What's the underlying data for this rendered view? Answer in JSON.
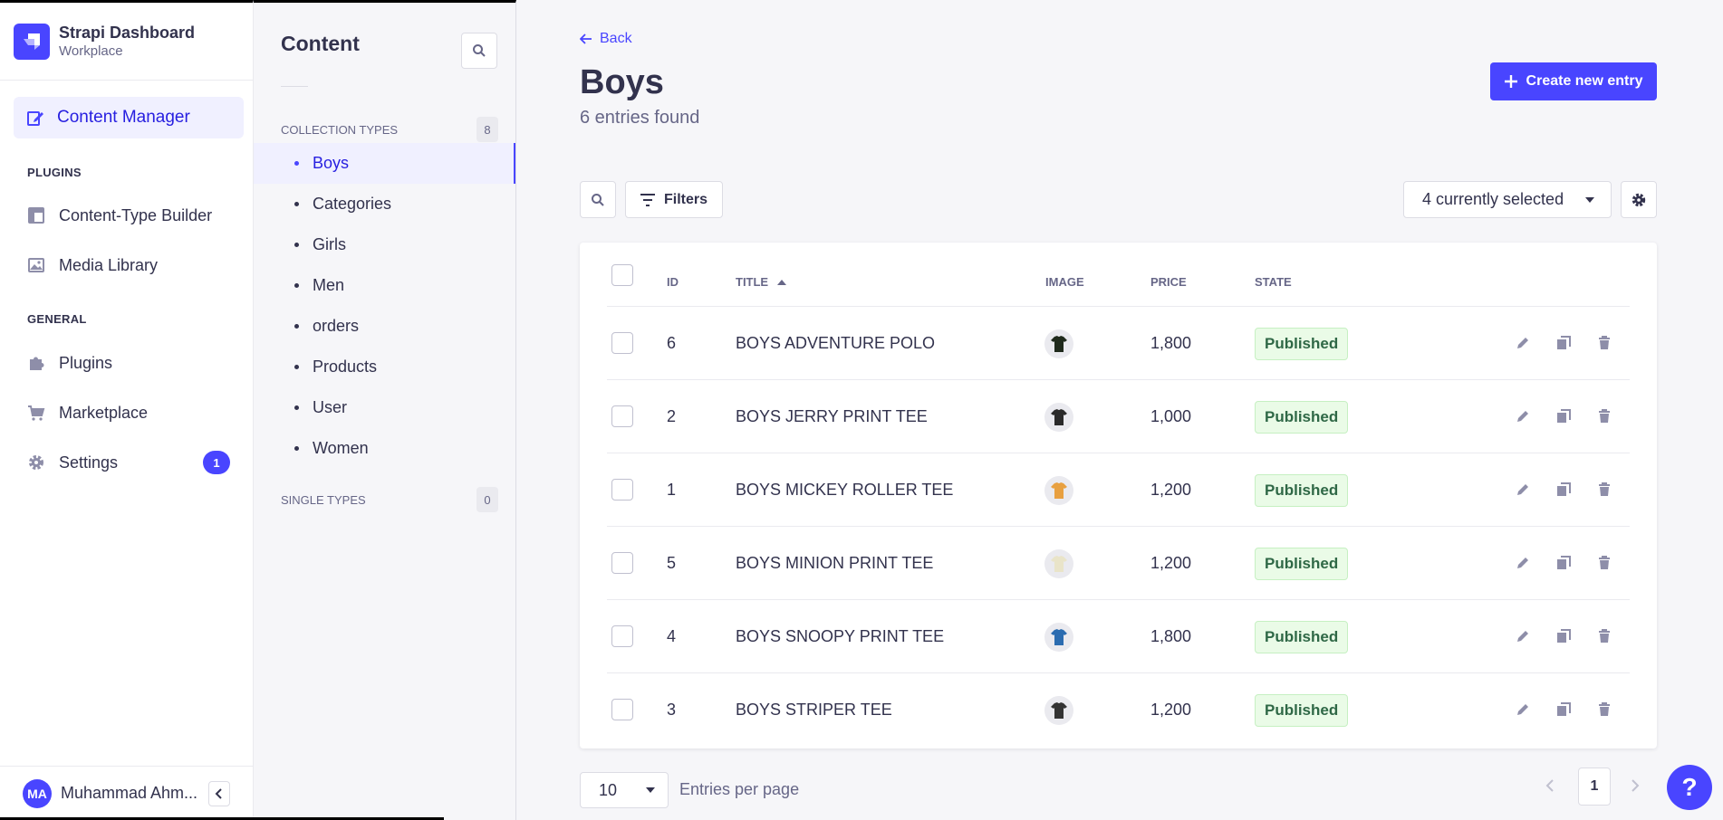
{
  "brand": {
    "name": "Strapi Dashboard",
    "subtitle": "Workplace"
  },
  "mainnav": {
    "active_item": "Content Manager",
    "plugins_heading": "PLUGINS",
    "plugins": [
      "Content-Type Builder",
      "Media Library"
    ],
    "general_heading": "GENERAL",
    "general": [
      "Plugins",
      "Marketplace",
      "Settings"
    ],
    "settings_badge": "1"
  },
  "user": {
    "initials": "MA",
    "name": "Muhammad Ahm..."
  },
  "subnav": {
    "title": "Content",
    "collection_heading": "COLLECTION TYPES",
    "collection_count": "8",
    "collection_items": [
      "Boys",
      "Categories",
      "Girls",
      "Men",
      "orders",
      "Products",
      "User",
      "Women"
    ],
    "active_item": "Boys",
    "single_heading": "SINGLE TYPES",
    "single_count": "0"
  },
  "header": {
    "back_label": "Back",
    "title": "Boys",
    "subtitle": "6 entries found",
    "create_label": "Create new entry"
  },
  "toolbar": {
    "filters_label": "Filters",
    "columns_select": "4 currently selected"
  },
  "table": {
    "headers": {
      "id": "ID",
      "title": "TITLE",
      "image": "IMAGE",
      "price": "PRICE",
      "state": "STATE"
    },
    "sort_indicator": "caret-up-icon",
    "rows": [
      {
        "id": "6",
        "title": "BOYS ADVENTURE POLO",
        "price": "1,800",
        "state": "Published",
        "thumb_color": "#1f2a1c"
      },
      {
        "id": "2",
        "title": "BOYS JERRY PRINT TEE",
        "price": "1,000",
        "state": "Published",
        "thumb_color": "#2a2a2a"
      },
      {
        "id": "1",
        "title": "BOYS MICKEY ROLLER TEE",
        "price": "1,200",
        "state": "Published",
        "thumb_color": "#e8a040"
      },
      {
        "id": "5",
        "title": "BOYS MINION PRINT TEE",
        "price": "1,200",
        "state": "Published",
        "thumb_color": "#e9e4c9"
      },
      {
        "id": "4",
        "title": "BOYS SNOOPY PRINT TEE",
        "price": "1,800",
        "state": "Published",
        "thumb_color": "#2b6cb0"
      },
      {
        "id": "3",
        "title": "BOYS STRIPER TEE",
        "price": "1,200",
        "state": "Published",
        "thumb_color": "#333333"
      }
    ]
  },
  "pagination": {
    "per_page": "10",
    "per_page_label": "Entries per page",
    "current_page": "1"
  },
  "help_label": "?",
  "colors": {
    "primary": "#4945ff",
    "published_bg": "#eafbe7",
    "published_text": "#2f6846"
  }
}
